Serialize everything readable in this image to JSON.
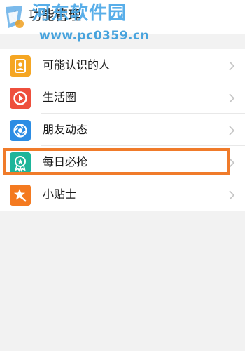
{
  "header": {
    "title": "功能管理",
    "back_icon": "chevron-left-icon"
  },
  "watermark": {
    "site_name": "河东软件园",
    "url": "www.pc0359.cn"
  },
  "menu": {
    "items": [
      {
        "label": "可能认识的人",
        "icon": "contact-card-icon",
        "color": "#f5a623"
      },
      {
        "label": "生活圈",
        "icon": "play-circle-icon",
        "color": "#ee4f3c"
      },
      {
        "label": "朋友动态",
        "icon": "aperture-icon",
        "color": "#2c8de4"
      },
      {
        "label": "每日必抢",
        "icon": "award-badge-icon",
        "color": "#1db59a"
      },
      {
        "label": "小贴士",
        "icon": "star-tip-icon",
        "color": "#f47a20"
      }
    ]
  },
  "highlight": {
    "color": "#f07b2a"
  }
}
